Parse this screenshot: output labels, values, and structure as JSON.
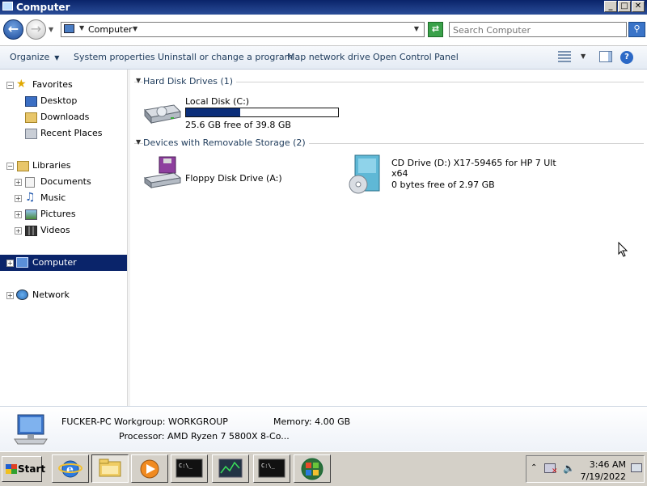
{
  "window": {
    "title": "Computer",
    "min_label": "_",
    "max_label": "□",
    "close_label": "✕"
  },
  "address": {
    "crumb": "Computer",
    "search_placeholder": "Search Computer"
  },
  "toolbar": {
    "organize": "Organize",
    "system_properties": "System properties",
    "uninstall": "Uninstall or change a program",
    "map_drive": "Map network drive",
    "control_panel": "Open Control Panel"
  },
  "nav": {
    "favorites": "Favorites",
    "desktop": "Desktop",
    "downloads": "Downloads",
    "recent_places": "Recent Places",
    "libraries": "Libraries",
    "documents": "Documents",
    "music": "Music",
    "pictures": "Pictures",
    "videos": "Videos",
    "computer": "Computer",
    "network": "Network"
  },
  "content": {
    "group_hdd": "Hard Disk Drives (1)",
    "local_disk_name": "Local Disk (C:)",
    "local_disk_free": "25.6 GB free of 39.8 GB",
    "local_disk_used_fraction": 0.357,
    "group_removable": "Devices with Removable Storage (2)",
    "floppy_name": "Floppy Disk Drive (A:)",
    "cd_name_line1": "CD Drive (D:) X17-59465 for HP 7 Ult",
    "cd_name_line2": "x64",
    "cd_free": "0 bytes free of 2.97 GB"
  },
  "details": {
    "pc_name": "FUCKER-PC",
    "workgroup": "Workgroup: WORKGROUP",
    "memory": "Memory: 4.00 GB",
    "processor": "Processor: AMD Ryzen 7 5800X 8-Co..."
  },
  "taskbar": {
    "start": "Start",
    "time": "3:46 AM",
    "date": "7/19/2022"
  },
  "colors": {
    "selection": "#0a246a",
    "capacity_fill": "#0b2e7a",
    "title_gradient_start": "#0a246a"
  }
}
